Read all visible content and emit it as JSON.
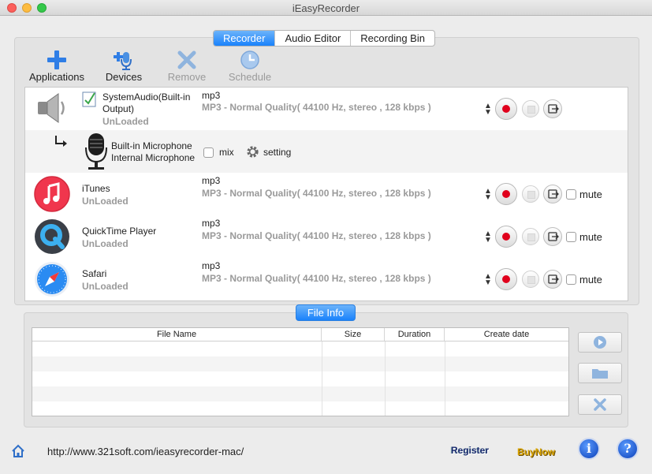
{
  "window": {
    "title": "iEasyRecorder"
  },
  "tabs": [
    {
      "label": "Recorder",
      "active": true
    },
    {
      "label": "Audio Editor",
      "active": false
    },
    {
      "label": "Recording Bin",
      "active": false
    }
  ],
  "toolbar": {
    "applications": "Applications",
    "devices": "Devices",
    "remove": "Remove",
    "schedule": "Schedule"
  },
  "sources": [
    {
      "name": "SystemAudio(Built-in Output)",
      "status": "UnLoaded",
      "format": "mp3",
      "quality": "MP3 - Normal Quality( 44100 Hz, stereo , 128 kbps )",
      "icon": "speaker-icon"
    },
    {
      "name": "iTunes",
      "status": "UnLoaded",
      "format": "mp3",
      "quality": "MP3 - Normal Quality( 44100 Hz, stereo , 128 kbps )",
      "mute": "mute",
      "icon": "itunes-icon"
    },
    {
      "name": "QuickTime Player",
      "status": "UnLoaded",
      "format": "mp3",
      "quality": "MP3 - Normal Quality( 44100 Hz, stereo , 128 kbps )",
      "mute": "mute",
      "icon": "quicktime-icon"
    },
    {
      "name": "Safari",
      "status": "UnLoaded",
      "format": "mp3",
      "quality": "MP3 - Normal Quality( 44100 Hz, stereo , 128 kbps )",
      "mute": "mute",
      "icon": "safari-icon"
    }
  ],
  "microphone": {
    "line1": "Built-in Microphone",
    "line2": "Internal Microphone",
    "mix": "mix",
    "setting": "setting"
  },
  "file_info": {
    "button": "File Info",
    "columns": [
      "File Name",
      "Size",
      "Duration",
      "Create date"
    ]
  },
  "footer": {
    "url": "http://www.321soft.com/ieasyrecorder-mac/",
    "register": "Register",
    "buynow": "BuyNow",
    "info": "i",
    "help": "?"
  },
  "colors": {
    "accent": "#1a82fb",
    "record": "#e0001c"
  }
}
